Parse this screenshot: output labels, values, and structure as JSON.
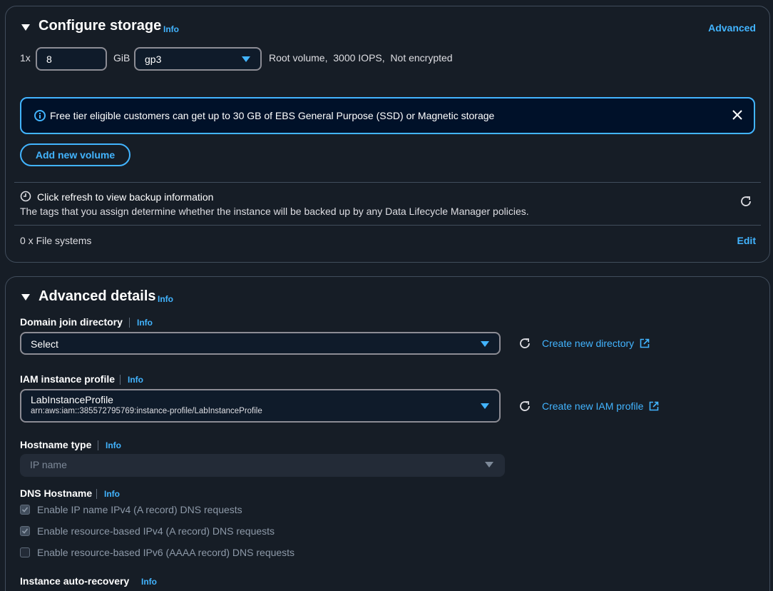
{
  "storage": {
    "title": "Configure storage",
    "info": "Info",
    "advanced_link": "Advanced",
    "count_prefix": "1x",
    "size_value": "8",
    "size_unit": "GiB",
    "volume_type": "gp3",
    "summary": "Root volume,  3000 IOPS,  Not encrypted",
    "banner_text": "Free tier eligible customers can get up to 30 GB of EBS General Purpose (SSD) or Magnetic storage",
    "add_volume_label": "Add new volume",
    "backup_title": "Click refresh to view backup information",
    "backup_desc": "The tags that you assign determine whether the instance will be backed up by any Data Lifecycle Manager policies.",
    "file_systems": "0 x File systems",
    "edit_label": "Edit"
  },
  "advanced": {
    "title": "Advanced details",
    "info": "Info",
    "domain_join": {
      "label": "Domain join directory",
      "info": "Info",
      "value": "Select",
      "create_link": "Create new directory"
    },
    "iam": {
      "label": "IAM instance profile",
      "info": "Info",
      "value": "LabInstanceProfile",
      "arn": "arn:aws:iam::385572795769:instance-profile/LabInstanceProfile",
      "create_link": "Create new IAM profile"
    },
    "hostname": {
      "label": "Hostname type",
      "info": "Info",
      "value": "IP name"
    },
    "dns": {
      "label": "DNS Hostname",
      "info": "Info",
      "options": [
        {
          "label": "Enable IP name IPv4 (A record) DNS requests",
          "checked": true
        },
        {
          "label": "Enable resource-based IPv4 (A record) DNS requests",
          "checked": true
        },
        {
          "label": "Enable resource-based IPv6 (AAAA record) DNS requests",
          "checked": false
        }
      ]
    },
    "next_label": "Instance auto-recovery",
    "next_info": "Info"
  },
  "colors": {
    "background": "#161d26",
    "accent": "#42b4ff",
    "border": "#414d5c",
    "banner_bg": "#001129"
  }
}
